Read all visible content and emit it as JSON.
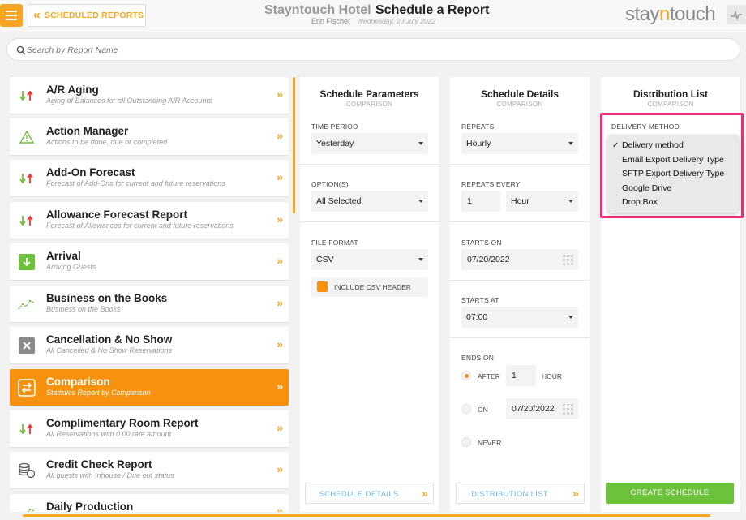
{
  "header": {
    "back_label": "SCHEDULED REPORTS",
    "hotel_name": "Stayntouch Hotel",
    "page_title": "Schedule a Report",
    "user_name": "Erin Fischer",
    "date": "Wednesday, 20 July 2022",
    "logo_prefix": "stay",
    "logo_accent": "n",
    "logo_suffix": "touch"
  },
  "search": {
    "placeholder": "Search by Report Name",
    "value": ""
  },
  "reports": [
    {
      "title": "A/R Aging",
      "subtitle": "Aging of Balances for all Outstanding A/R Accounts",
      "icon": "arrows-up-down-icon"
    },
    {
      "title": "Action Manager",
      "subtitle": "Actions to be done, due or completed",
      "icon": "warning-icon"
    },
    {
      "title": "Add-On Forecast",
      "subtitle": "Forecast of Add-Ons for current and future reservations",
      "icon": "arrows-up-down-icon"
    },
    {
      "title": "Allowance Forecast Report",
      "subtitle": "Forecast of Allowances for current and future reservations",
      "icon": "arrows-up-down-icon"
    },
    {
      "title": "Arrival",
      "subtitle": "Arriving Guests",
      "icon": "arrival-icon"
    },
    {
      "title": "Business on the Books",
      "subtitle": "Business on the Books",
      "icon": "trend-icon"
    },
    {
      "title": "Cancellation & No Show",
      "subtitle": "All Cancelled & No Show Reservations",
      "icon": "cancel-icon"
    },
    {
      "title": "Comparison",
      "subtitle": "Statistics Report by Comparison",
      "icon": "compare-icon"
    },
    {
      "title": "Complimentary Room Report",
      "subtitle": "All Reservations with 0.00 rate amount",
      "icon": "arrows-up-down-icon"
    },
    {
      "title": "Credit Check Report",
      "subtitle": "All guests with Inhouse / Due out status",
      "icon": "coins-icon"
    },
    {
      "title": "Daily Production",
      "subtitle": "",
      "icon": "trend-icon"
    }
  ],
  "active_report_index": 7,
  "schedule_parameters": {
    "title": "Schedule Parameters",
    "subtitle": "COMPARISON",
    "time_period_label": "TIME PERIOD",
    "time_period_value": "Yesterday",
    "options_label": "OPTION(S)",
    "options_value": "All Selected",
    "file_format_label": "FILE FORMAT",
    "file_format_value": "CSV",
    "include_header_label": "INCLUDE CSV HEADER",
    "footer_button": "SCHEDULE DETAILS"
  },
  "schedule_details": {
    "title": "Schedule Details",
    "subtitle": "COMPARISON",
    "repeats_label": "REPEATS",
    "repeats_value": "Hourly",
    "repeats_every_label": "REPEATS EVERY",
    "repeats_every_value": "1",
    "repeats_every_unit": "Hour",
    "starts_on_label": "STARTS ON",
    "starts_on_value": "07/20/2022",
    "starts_at_label": "STARTS AT",
    "starts_at_value": "07:00",
    "ends_on_label": "ENDS ON",
    "after_label": "AFTER",
    "after_value": "1",
    "after_unit": "HOUR",
    "on_label": "ON",
    "on_value": "07/20/2022",
    "never_label": "NEVER",
    "footer_button": "DISTRIBUTION LIST"
  },
  "distribution_list": {
    "title": "Distribution List",
    "subtitle": "COMPARISON",
    "delivery_method_label": "DELIVERY METHOD",
    "options": [
      "Delivery method",
      "Email Export Delivery Type",
      "SFTP Export Delivery Type",
      "Google Drive",
      "Drop Box"
    ],
    "selected_index": 0,
    "check_mark": "✓",
    "create_button": "CREATE SCHEDULE"
  },
  "colors": {
    "accent": "#f6a623",
    "active": "#f6920f",
    "create": "#6cc23a",
    "highlight": "#ec2d77",
    "link": "#6cb6e6"
  }
}
